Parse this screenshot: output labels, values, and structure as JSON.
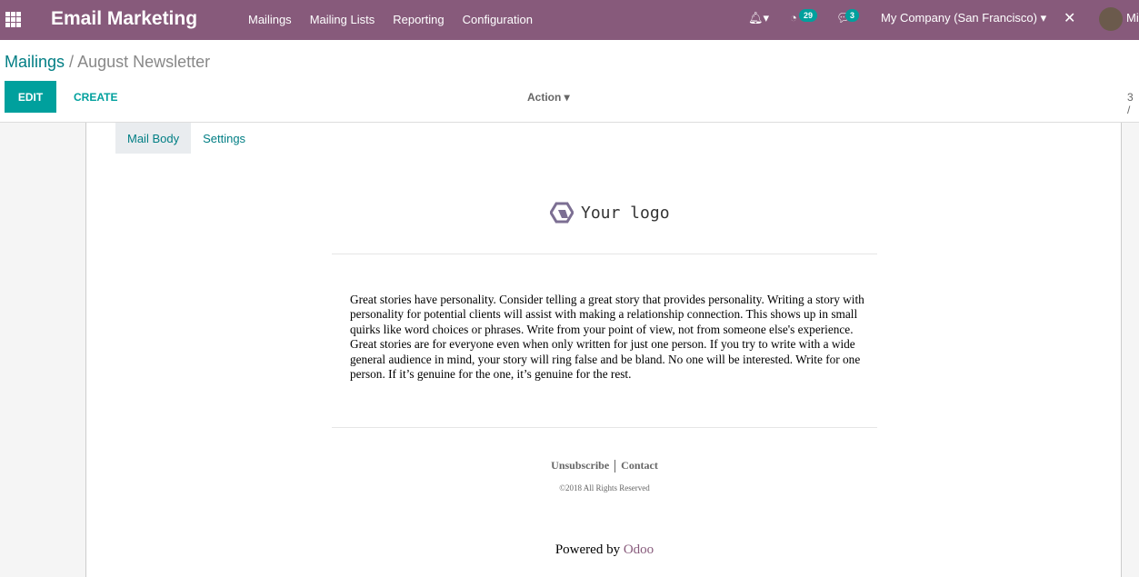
{
  "navbar": {
    "app_title": "Email Marketing",
    "menu": [
      "Mailings",
      "Mailing Lists",
      "Reporting",
      "Configuration"
    ],
    "activity_count": "29",
    "message_count": "3",
    "company": "My Company (San Francisco)",
    "user_initials": "Mi"
  },
  "breadcrumb": {
    "parent": "Mailings",
    "current": "August Newsletter",
    "separator": "/"
  },
  "toolbar": {
    "edit": "EDIT",
    "create": "CREATE",
    "action": "Action",
    "pager": "3 /"
  },
  "tabs": [
    "Mail Body",
    "Settings"
  ],
  "mail": {
    "logo_text": "Your logo",
    "paragraphs": [
      "Great stories have personality. Consider telling a great story that provides personality. Writing a story with personality for potential clients will assist with making a relationship connection. This shows up in small quirks like word choices or phrases. Write from your point of view, not from someone else's experience.",
      "Great stories are for everyone even when only written for just one person. If you try to write with a wide general audience in mind, your story will ring false and be bland. No one will be interested. Write for one person. If it’s genuine for the one, it’s genuine for the rest."
    ],
    "unsubscribe": "Unsubscribe",
    "contact": "Contact",
    "copyright": "©2018 All Rights Reserved",
    "powered_by": "Powered by",
    "odoo": "Odoo"
  },
  "colors": {
    "brand": "#875a7b",
    "accent": "#00a09d"
  }
}
